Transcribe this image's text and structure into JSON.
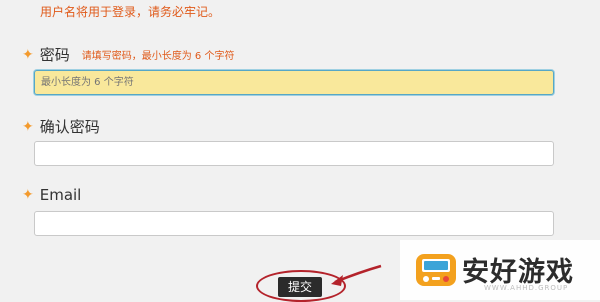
{
  "notice": "用户名将用于登录，请务必牢记。",
  "password": {
    "label": "密码",
    "hint": "请填写密码，最小长度为 6 个字符",
    "placeholder": "最小长度为 6 个字符"
  },
  "confirm_password": {
    "label": "确认密码",
    "placeholder": ""
  },
  "email": {
    "label": "Email",
    "placeholder": ""
  },
  "submit_label": "提交",
  "watermark": {
    "name": "安好游戏",
    "sub": "WWW.AHHD.GROUP"
  }
}
